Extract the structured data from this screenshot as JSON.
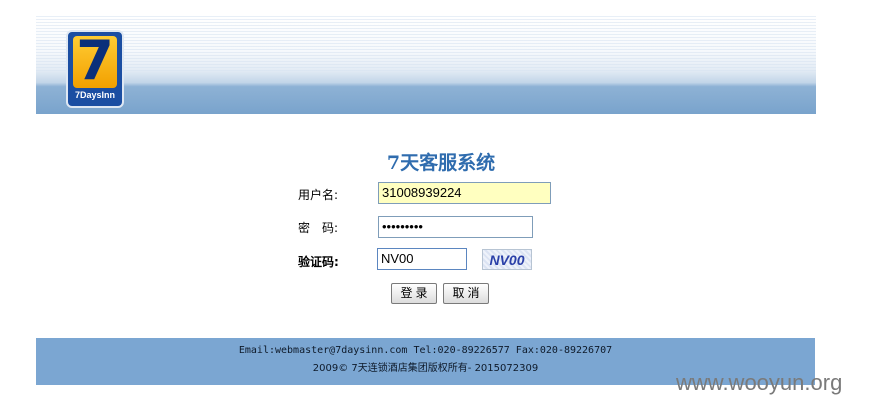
{
  "header": {
    "logo_number": "7",
    "logo_text": "7DaysInn"
  },
  "title": "7天客服系统",
  "form": {
    "username_label": "用户名:",
    "username_value": "31008939224",
    "password_label": "密　码:",
    "password_value": "•••••••••",
    "captcha_label": "验证码:",
    "captcha_value": "NV00",
    "captcha_image_text": "NV00",
    "login_button": "登录",
    "cancel_button": "取消"
  },
  "footer": {
    "contact": "Email:webmaster@7daysinn.com Tel:020-89226577 Fax:020-89226707",
    "copyright": "2009© 7天连锁酒店集团版权所有-   2015072309"
  },
  "watermark": "www.wooyun.org"
}
